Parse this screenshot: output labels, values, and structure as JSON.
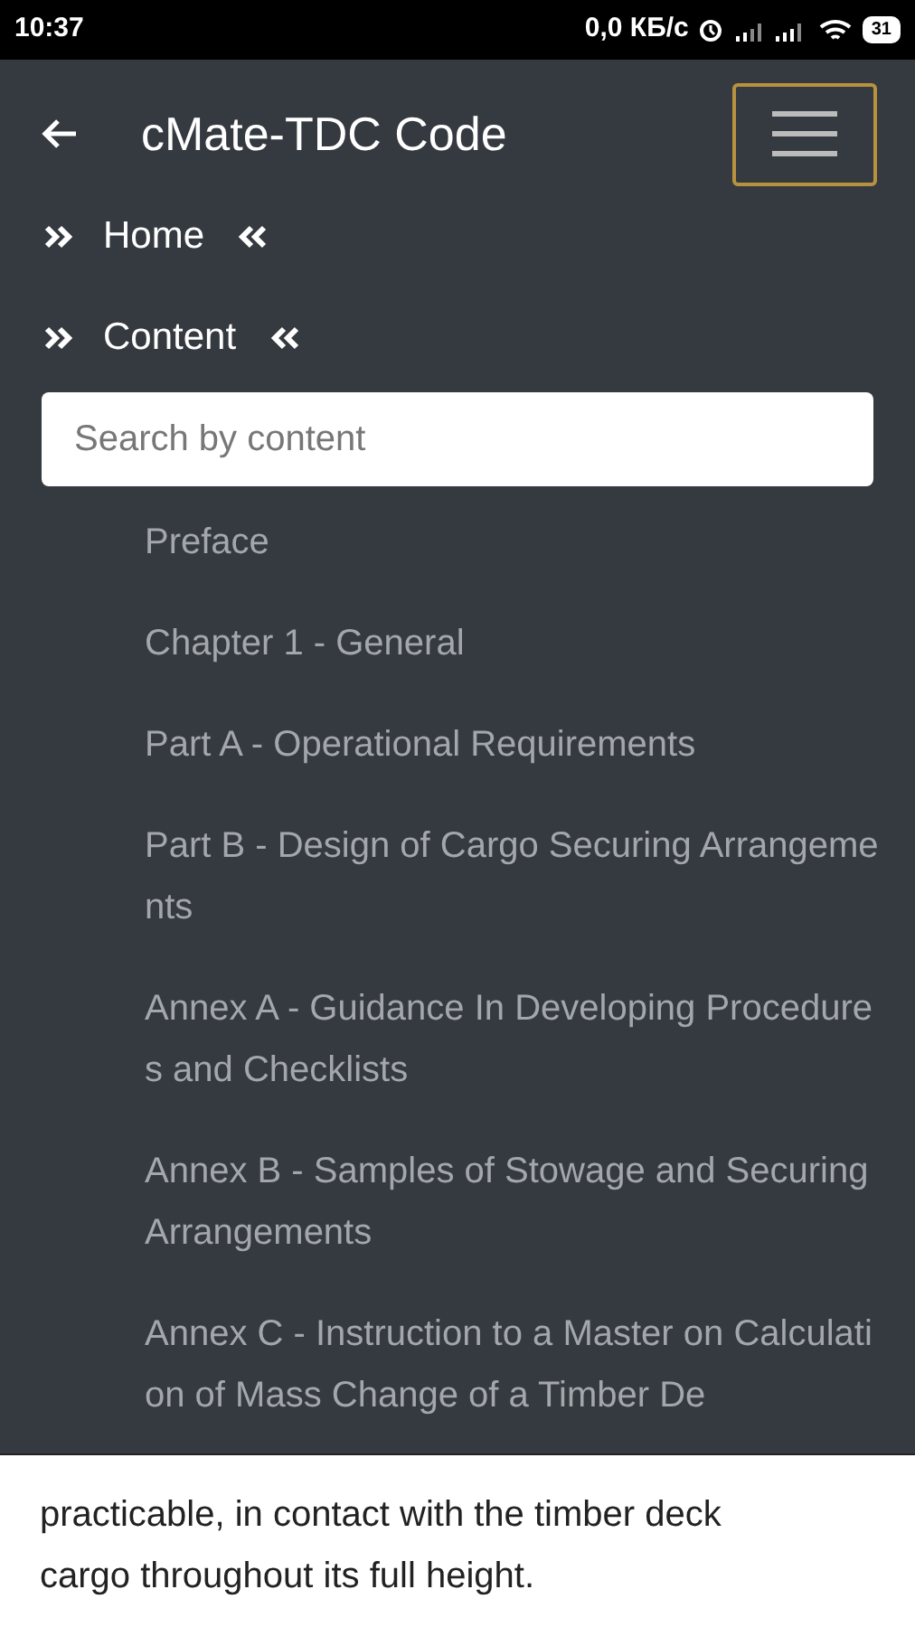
{
  "status_bar": {
    "time": "10:37",
    "speed": "0,0 КБ/с",
    "battery": "31"
  },
  "app_bar": {
    "title": "cMate-TDC Code"
  },
  "nav": [
    {
      "label": "Home"
    },
    {
      "label": "Content"
    }
  ],
  "search": {
    "placeholder": "Search by content"
  },
  "contents": [
    {
      "label": "Preface"
    },
    {
      "label": "Chapter 1 - General"
    },
    {
      "label": "Part A - Operational Requirements"
    },
    {
      "label": "Part B - Design of Cargo Securing Arrangements"
    },
    {
      "label": "Annex A - Guidance In Developing Procedures and Checklists"
    },
    {
      "label": "Annex B - Samples of Stowage and Securing Arrangements"
    },
    {
      "label": "Annex C - Instruction to a Master on Calculation of Mass Change of a Timber De"
    }
  ],
  "body_text": "practicable, in contact with the timber deck cargo throughout its full height."
}
